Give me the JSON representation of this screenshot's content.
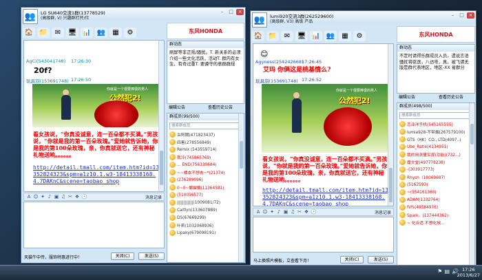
{
  "window1": {
    "title": "LG SU640交流1群(13778529)",
    "status": "(高级群, V) 兴趣群打开/仕",
    "chat": {
      "sender1": "AgCi(543041748)",
      "time1": "17:26:30",
      "msg1": "20f?",
      "sender2": "玩具羽(153691748)",
      "time2": "17:26:50",
      "ad_headline": "公然犯2!",
      "ad_sub": "你就是一个很要捧很的男人",
      "red_text": "看女孩说，“你真没诚意，连一百朵都不买满。”男孩说，“你就是我的第一百朵玫瑰。”爱她就告诉她，你是我的第100朵玫瑰，亲，你真就送它，还有神秘礼物送哟。。。。。。",
      "link_text": "http://detail.tmall.com/item.htm?id=13352824323&spm=a1z10.1.w3-18413338168.4.7DAKnC&scene=taobao_shop"
    },
    "history_label": "消息记录",
    "status_text": "天猫牛中传，服饰特惠进行中！",
    "close_btn": "关闭(C)",
    "send_btn": "发送(S)",
    "side": {
      "brand": "东风HONDA",
      "notice_header": "群动态",
      "notice_text": "刷屏等非正规/骚扰。T. 新关系的必须介绍一些文化活跃，活动T. 群内有女生，有奇过重T. 要遵守的意群群规",
      "edit_notice": "编辑公告",
      "history_notice": "查看历史公告",
      "members_header": "群成员(99/500)",
      "search_placeholder": "搜索群成员",
      "members": [
        {
          "name": "古阿期(471823437)",
          "color": "gry"
        },
        {
          "name": "四害(278556849)",
          "color": "gry"
        },
        {
          "name": "Remix (543559714)",
          "color": "gry"
        },
        {
          "name": "我冷(745865769)",
          "color": "red2"
        },
        {
          "name": "... END(756330684)",
          "color": "red2"
        },
        {
          "name": "~~橘衣不想去~*(21374)",
          "color": "red2"
        },
        {
          "name": "(276289096)",
          "color": "red2"
        },
        {
          "name": "0~0~懒猫懒(11364581)",
          "color": "red2"
        },
        {
          "name": "(510056577)",
          "color": "red2"
        },
        {
          "name": "||||||||||||(1009081/72)",
          "color": "gry"
        },
        {
          "name": "Caitlyn(1336078B9)",
          "color": "gry"
        },
        {
          "name": "DS(67669299)",
          "color": "gry"
        },
        {
          "name": "叶莉(1032068936)",
          "color": "gry"
        },
        {
          "name": "Lipaky(679098191)",
          "color": "gry"
        }
      ]
    }
  },
  "window2": {
    "title": "lumi920交流3群(262529600)",
    "status": "(高级群, V3) 高级 产品",
    "chat": {
      "sender1": "Agyness(254242668)",
      "time1": "17:26:45",
      "msg1": "艾玛 你俩这是桃基情么?",
      "sender2": "玩具羽(153691748)",
      "time2": "17:26:52",
      "ad_headline": "公然犯2!",
      "ad_sub": "你就是一个很要捧很的男人",
      "red_text": "看女孩说，“你真没诚意，连一百朵都不买满。”男孩说，“你就是我的第一百朵玫瑰。”爱她就告诉她，你是我的第100朵玫瑰，亲，你真就送它，还有神秘礼物送哟。。。。。。",
      "link_text": "http://detail.tmall.com/item.htm?id=13352824323&spm=a1z10.1.w3-18413338168.4.7DAKnC&scene=taobao_shop"
    },
    "history_label": "消息记录",
    "status_text": "马上换照片模板，立查看下月！",
    "close_btn": "关闭(C)",
    "send_btn": "发送(S)",
    "side": {
      "brand": "东风HONDA",
      "notice_header": "群动态",
      "notice_text": "不定时请得乐群成员入员，遗说言语骚扰将驱逐，八达哇，真，被飞请无版是群代表地区，地区-XX 省群分",
      "edit_notice": "编辑公告",
      "history_notice": "查看历史公告",
      "members_header": "群成员(498/500)",
      "search_placeholder": "搜索群成员",
      "members": [
        {
          "name": "恋泽洋手机(545165555)",
          "color": "red2"
        },
        {
          "name": "lumia928-不带烟(267579100)",
          "color": "gry"
        },
        {
          "name": "GTS（HK）CO., LTD(4097..)",
          "color": "gry"
        },
        {
          "name": "Ube_Ratio(4134951)",
          "color": "red2"
        },
        {
          "name": "我的用测量实现(功能)(732...)",
          "color": "red2"
        },
        {
          "name": "魔文堂(497778238)",
          "color": "red2"
        },
        {
          "name": "-(303917773)",
          "color": "red2"
        },
        {
          "name": "Rhysh（18069687）",
          "color": "red2"
        },
        {
          "name": "(5162593)",
          "color": "red2"
        },
        {
          "name": "~(554161360)",
          "color": "red2"
        },
        {
          "name": "ADAM(1332764)",
          "color": "red2"
        },
        {
          "name": "fVfs(49584976)",
          "color": "red2"
        },
        {
          "name": "Spark。(137444362)",
          "color": "red2"
        },
        {
          "name": "~ 化合适 不想化放...",
          "color": "red2"
        }
      ]
    }
  },
  "taskbar": {
    "time": "17:26",
    "date": "2013/6/27"
  }
}
